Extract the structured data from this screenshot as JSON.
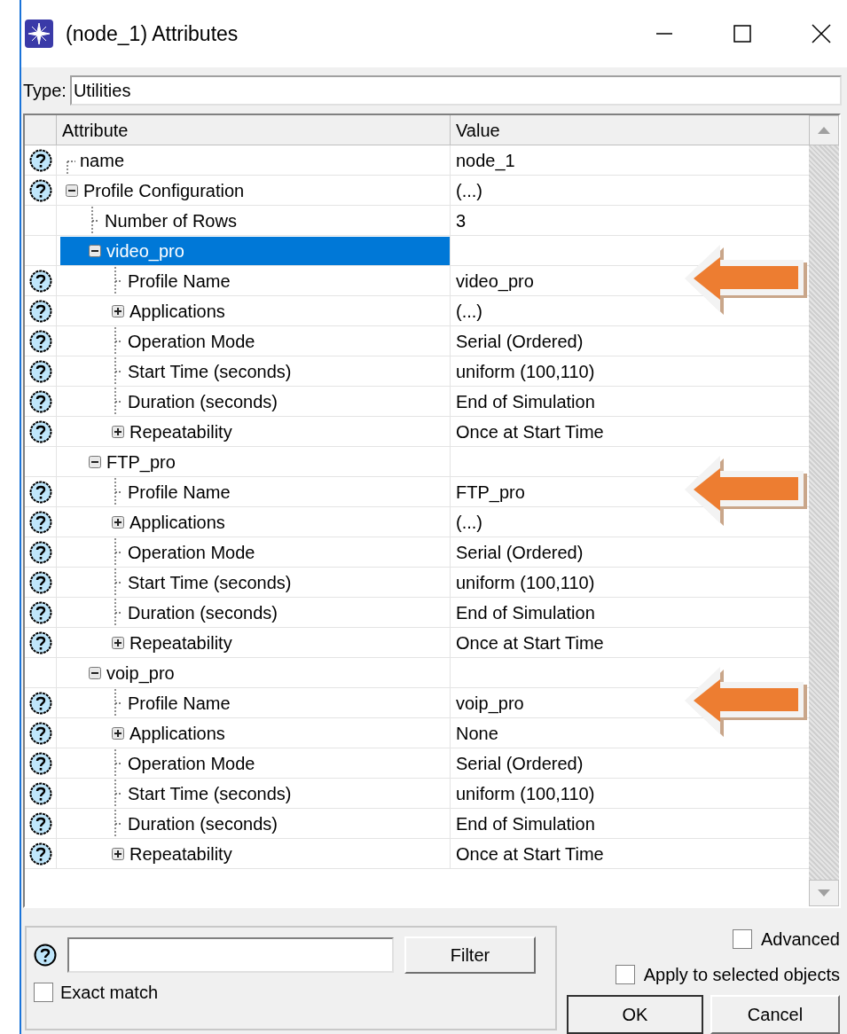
{
  "window": {
    "title": "(node_1) Attributes"
  },
  "type_field": {
    "label": "Type:",
    "value": "Utilities"
  },
  "table": {
    "columns": [
      "Attribute",
      "Value"
    ],
    "rows": [
      {
        "attribute": "name",
        "value": "node_1",
        "help": true,
        "selected": false
      },
      {
        "attribute": "Profile Configuration",
        "value": "(...)",
        "help": true,
        "expanded": true,
        "selected": false,
        "children": [
          {
            "attribute": "Number of Rows",
            "value": "3",
            "help": false,
            "selected": false
          },
          {
            "attribute": "video_pro",
            "help": false,
            "expanded": true,
            "selected": true,
            "children": [
              {
                "attribute": "Profile Name",
                "value": "video_pro",
                "help": true,
                "selected": false,
                "arrow": true
              },
              {
                "attribute": "Applications",
                "value": "(...)",
                "help": true,
                "expanded": false,
                "selected": false
              },
              {
                "attribute": "Operation Mode",
                "value": "Serial (Ordered)",
                "help": true,
                "selected": false
              },
              {
                "attribute": "Start Time (seconds)",
                "value": "uniform (100,110)",
                "help": true,
                "selected": false
              },
              {
                "attribute": "Duration (seconds)",
                "value": "End of Simulation",
                "help": true,
                "selected": false
              },
              {
                "attribute": "Repeatability",
                "value": "Once at Start Time",
                "help": true,
                "expanded": false,
                "selected": false
              }
            ]
          },
          {
            "attribute": "FTP_pro",
            "help": false,
            "expanded": true,
            "selected": false,
            "children": [
              {
                "attribute": "Profile Name",
                "value": "FTP_pro",
                "help": true,
                "selected": false,
                "arrow": true
              },
              {
                "attribute": "Applications",
                "value": "(...)",
                "help": true,
                "expanded": false,
                "selected": false
              },
              {
                "attribute": "Operation Mode",
                "value": "Serial (Ordered)",
                "help": true,
                "selected": false
              },
              {
                "attribute": "Start Time (seconds)",
                "value": "uniform (100,110)",
                "help": true,
                "selected": false
              },
              {
                "attribute": "Duration (seconds)",
                "value": "End of Simulation",
                "help": true,
                "selected": false
              },
              {
                "attribute": "Repeatability",
                "value": "Once at Start Time",
                "help": true,
                "expanded": false,
                "selected": false
              }
            ]
          },
          {
            "attribute": "voip_pro",
            "help": false,
            "expanded": true,
            "selected": false,
            "children": [
              {
                "attribute": "Profile Name",
                "value": "voip_pro",
                "help": true,
                "selected": false,
                "arrow": true
              },
              {
                "attribute": "Applications",
                "value": "None",
                "help": true,
                "expanded": false,
                "selected": false
              },
              {
                "attribute": "Operation Mode",
                "value": "Serial (Ordered)",
                "help": true,
                "selected": false
              },
              {
                "attribute": "Start Time (seconds)",
                "value": "uniform (100,110)",
                "help": true,
                "selected": false
              },
              {
                "attribute": "Duration (seconds)",
                "value": "End of Simulation",
                "help": true,
                "selected": false
              },
              {
                "attribute": "Repeatability",
                "value": "Once at Start Time",
                "help": true,
                "expanded": false,
                "selected": false
              }
            ]
          }
        ]
      }
    ]
  },
  "filter": {
    "button": {
      "label": "Filter"
    },
    "exact_match": {
      "label": "Exact match",
      "checked": false
    }
  },
  "options": [
    {
      "label": "Advanced",
      "checked": false
    },
    {
      "label": "Apply to selected objects",
      "checked": false
    }
  ],
  "buttons": [
    {
      "label": "OK"
    },
    {
      "label": "Cancel"
    }
  ]
}
